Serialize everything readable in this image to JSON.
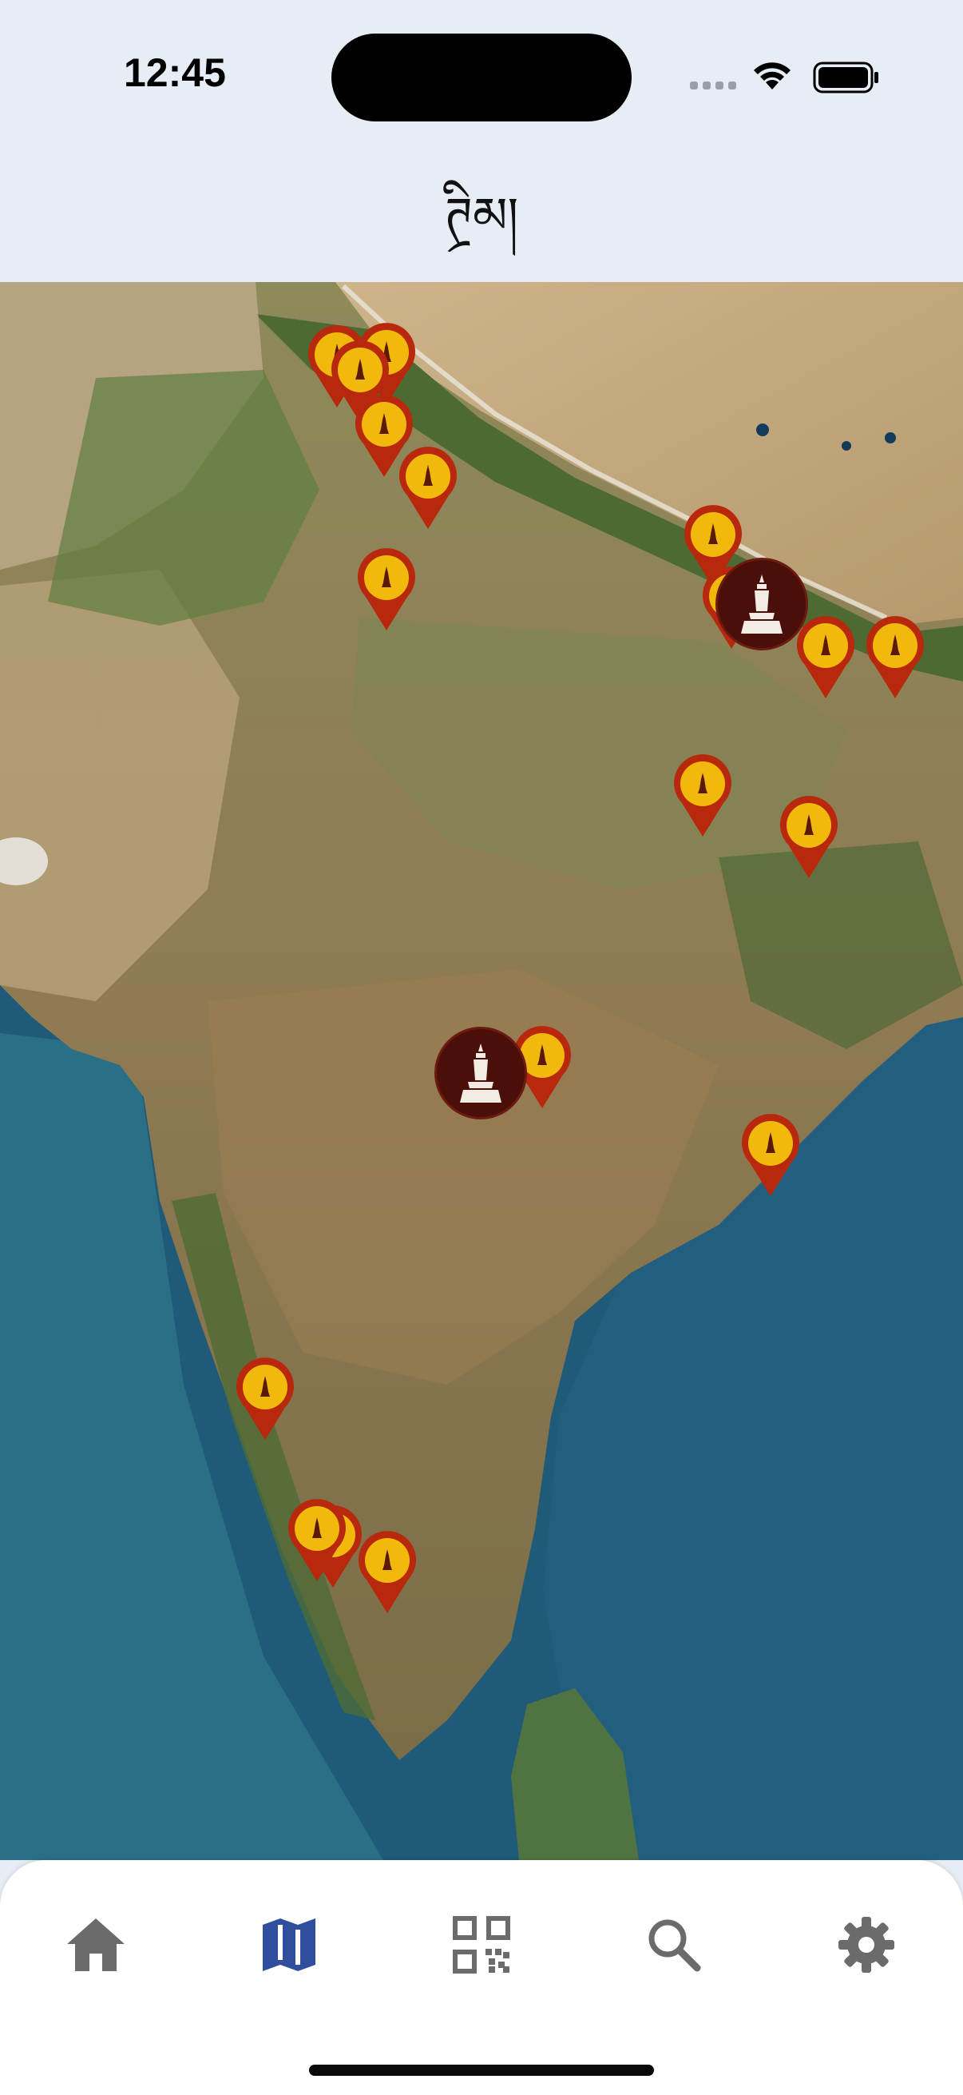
{
  "status_bar": {
    "time": "12:45"
  },
  "header": {
    "title": "ཊྲིམ།"
  },
  "map": {
    "layer": "satellite",
    "region": "India"
  },
  "tab_bar": {
    "tabs": [
      {
        "id": "home",
        "icon": "home-icon",
        "selected": false
      },
      {
        "id": "map",
        "icon": "map-icon",
        "selected": true
      },
      {
        "id": "qr",
        "icon": "qr-code-icon",
        "selected": false
      },
      {
        "id": "search",
        "icon": "search-icon",
        "selected": false
      },
      {
        "id": "settings",
        "icon": "gear-icon",
        "selected": false
      }
    ]
  },
  "colors": {
    "pin_fill": "#c2310a",
    "pin_inner": "#f2b90d",
    "cluster_fill": "#4a0f08",
    "tab_active": "#2f4f9e",
    "tab_inactive": "#6b6b6b",
    "header_bg": "#e7edf5"
  }
}
